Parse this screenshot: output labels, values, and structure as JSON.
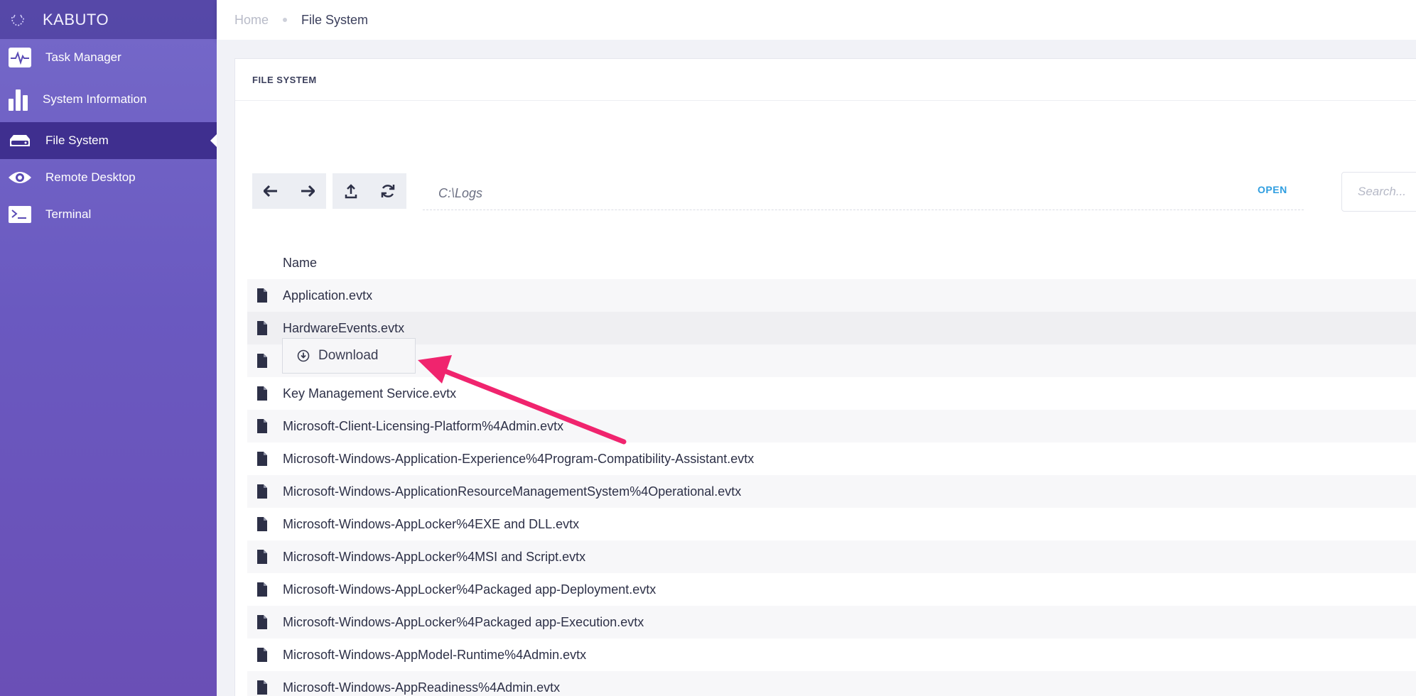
{
  "brand": {
    "name": "KABUTO"
  },
  "sidebar": {
    "items": [
      {
        "label": "Task Manager",
        "icon": "pulse-icon",
        "active": false
      },
      {
        "label": "System Information",
        "icon": "bar-chart-icon",
        "active": false
      },
      {
        "label": "File System",
        "icon": "hard-drive-icon",
        "active": true
      },
      {
        "label": "Remote Desktop",
        "icon": "eye-icon",
        "active": false
      },
      {
        "label": "Terminal",
        "icon": "terminal-icon",
        "active": false
      }
    ]
  },
  "breadcrumb": {
    "home": "Home",
    "current": "File System"
  },
  "card": {
    "title": "FILE SYSTEM"
  },
  "toolbar": {
    "back_icon": "arrow-left-icon",
    "forward_icon": "arrow-right-icon",
    "upload_icon": "upload-icon",
    "refresh_icon": "refresh-icon",
    "path_value": "C:\\Logs",
    "open_label": "OPEN",
    "search_placeholder": "Search..."
  },
  "table": {
    "header_name": "Name",
    "rows": [
      "Application.evtx",
      "HardwareEvents.evtx",
      "",
      "Key Management Service.evtx",
      "Microsoft-Client-Licensing-Platform%4Admin.evtx",
      "Microsoft-Windows-Application-Experience%4Program-Compatibility-Assistant.evtx",
      "Microsoft-Windows-ApplicationResourceManagementSystem%4Operational.evtx",
      "Microsoft-Windows-AppLocker%4EXE and DLL.evtx",
      "Microsoft-Windows-AppLocker%4MSI and Script.evtx",
      "Microsoft-Windows-AppLocker%4Packaged app-Deployment.evtx",
      "Microsoft-Windows-AppLocker%4Packaged app-Execution.evtx",
      "Microsoft-Windows-AppModel-Runtime%4Admin.evtx",
      "Microsoft-Windows-AppReadiness%4Admin.evtx"
    ]
  },
  "context_menu": {
    "download_label": "Download"
  },
  "colors": {
    "accent": "#2f9ee0",
    "annotation_arrow": "#f0246e",
    "sidebar_active": "#3f2f8f"
  }
}
